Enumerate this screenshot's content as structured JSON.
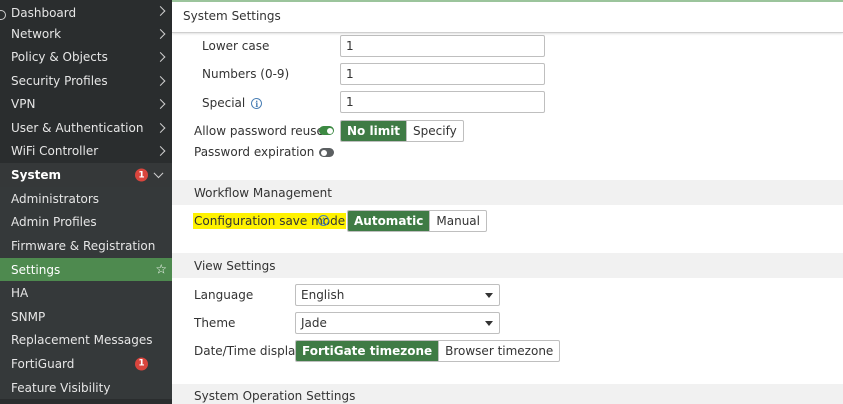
{
  "sidebar": {
    "items": [
      {
        "label": "Dashboard"
      },
      {
        "label": "Network"
      },
      {
        "label": "Policy & Objects"
      },
      {
        "label": "Security Profiles"
      },
      {
        "label": "VPN"
      },
      {
        "label": "User & Authentication"
      },
      {
        "label": "WiFi Controller"
      }
    ],
    "system": {
      "label": "System",
      "badge": "1"
    },
    "sub_items": [
      {
        "label": "Administrators"
      },
      {
        "label": "Admin Profiles"
      },
      {
        "label": "Firmware & Registration"
      },
      {
        "label": "Settings"
      },
      {
        "label": "HA"
      },
      {
        "label": "SNMP"
      },
      {
        "label": "Replacement Messages"
      },
      {
        "label": "FortiGuard",
        "badge": "1"
      },
      {
        "label": "Feature Visibility"
      }
    ]
  },
  "header": {
    "title": "System Settings"
  },
  "password_policy": {
    "lower_case": {
      "label": "Lower case",
      "value": "1"
    },
    "numbers": {
      "label": "Numbers (0-9)",
      "value": "1"
    },
    "special": {
      "label": "Special",
      "value": "1"
    },
    "allow_reuse": {
      "label": "Allow password reuse",
      "enabled": true,
      "options": [
        "No limit",
        "Specify"
      ],
      "selected": "No limit"
    },
    "expiration": {
      "label": "Password expiration",
      "enabled": false
    }
  },
  "workflow": {
    "section_title": "Workflow Management",
    "save_mode": {
      "label": "Configuration save mode",
      "options": [
        "Automatic",
        "Manual"
      ],
      "selected": "Automatic"
    }
  },
  "view_settings": {
    "section_title": "View Settings",
    "language": {
      "label": "Language",
      "value": "English"
    },
    "theme": {
      "label": "Theme",
      "value": "Jade"
    },
    "datetime": {
      "label": "Date/Time display",
      "options": [
        "FortiGate timezone",
        "Browser timezone"
      ],
      "selected": "FortiGate timezone"
    }
  },
  "system_operation": {
    "section_title": "System Operation Settings"
  },
  "colors": {
    "accent": "#3f7b45",
    "sidebar_bg": "#2a2d2e",
    "badge": "#d9453d",
    "highlight": "#fff200"
  }
}
